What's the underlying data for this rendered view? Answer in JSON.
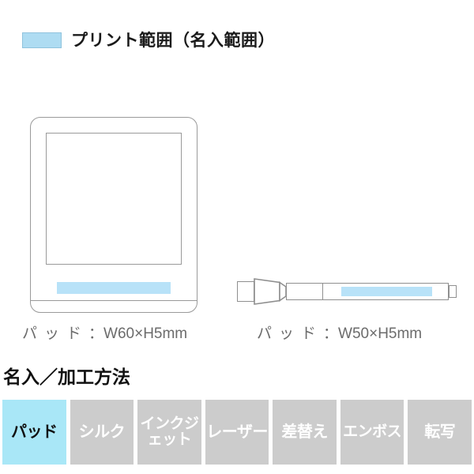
{
  "legend": {
    "swatch_color": "#aedcf2",
    "label": "プリント範囲（名入範囲）"
  },
  "illustrations": [
    {
      "name": "pad-notepad",
      "print_area_color": "#b8e2f8",
      "caption_jp": "パッド",
      "caption_sep": "：",
      "caption_size": "W60×H5mm"
    },
    {
      "name": "pen",
      "print_area_color": "#b8e2f8",
      "caption_jp": "パッド",
      "caption_sep": "：",
      "caption_size": "W50×H5mm"
    }
  ],
  "section": {
    "heading": "名入／加工方法"
  },
  "methods": {
    "active_color": "#a9e7f7",
    "inactive_color": "#cccccc",
    "items": [
      {
        "label": "パッド",
        "active": true
      },
      {
        "label": "シルク",
        "active": false
      },
      {
        "label": "インクジェット",
        "active": false
      },
      {
        "label": "レーザー",
        "active": false
      },
      {
        "label": "差替え",
        "active": false
      },
      {
        "label": "エンボス",
        "active": false
      },
      {
        "label": "転写",
        "active": false
      }
    ]
  }
}
